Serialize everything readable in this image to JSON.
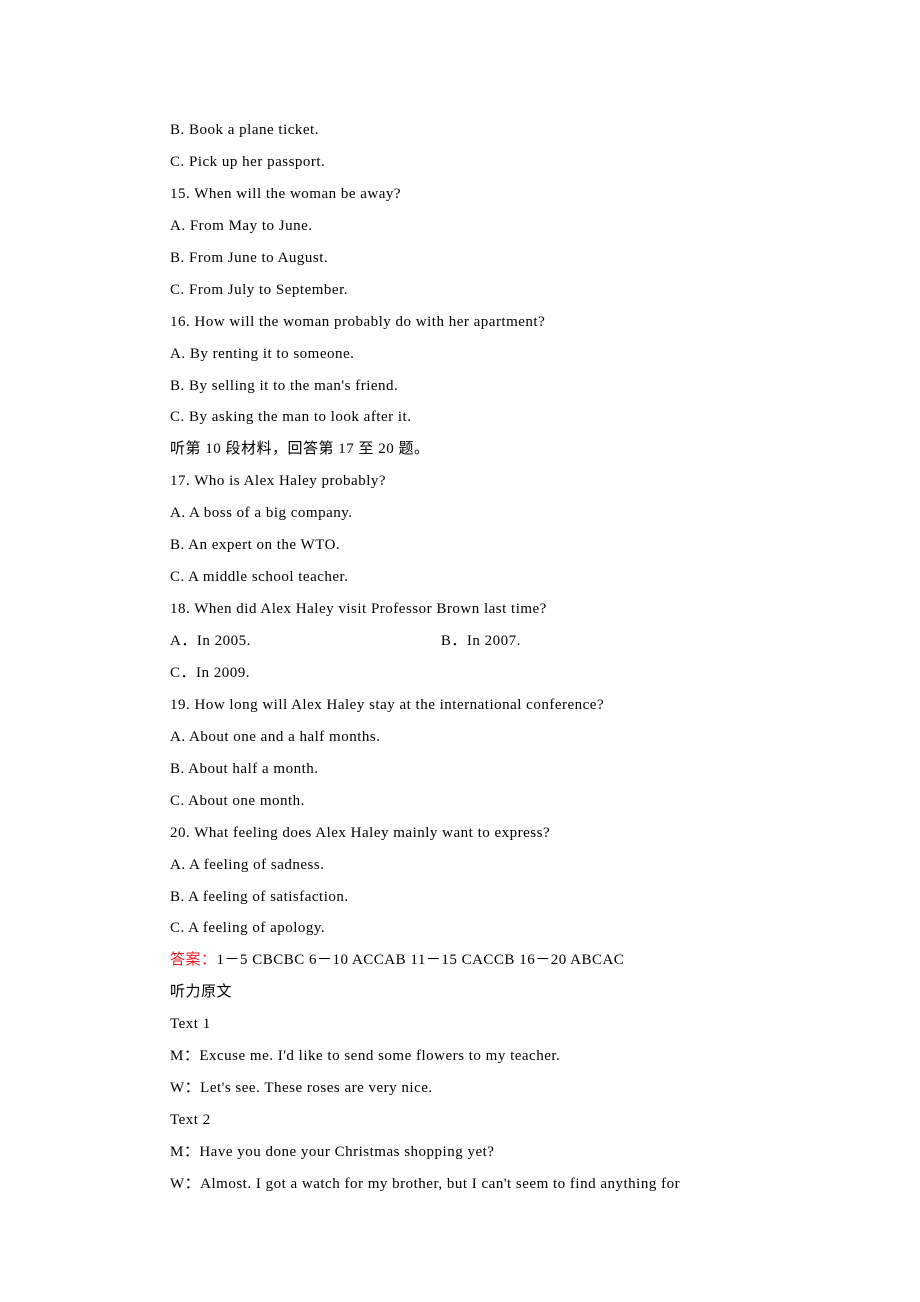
{
  "lines": [
    {
      "text": "B. Book a plane ticket."
    },
    {
      "text": "C. Pick up her passport."
    },
    {
      "text": "15. When will the woman be away?"
    },
    {
      "text": "A. From May to June."
    },
    {
      "text": "B. From June to August."
    },
    {
      "text": "C. From July to September."
    },
    {
      "text": "16. How will the woman probably do with her apartment?"
    },
    {
      "text": "A. By renting it to someone."
    },
    {
      "text": "B. By selling it to the man's friend."
    },
    {
      "text": "C. By asking the man to look after it."
    },
    {
      "text": "听第 10 段材料，回答第 17 至 20 题。"
    },
    {
      "text": "17. Who is Alex Haley probably?"
    },
    {
      "text": "A. A boss of a big company."
    },
    {
      "text": "B. An expert on the WTO."
    },
    {
      "text": "C. A middle school teacher."
    },
    {
      "text": "18. When did Alex Haley visit Professor Brown last time?"
    },
    {
      "type": "split",
      "a": "A．In 2005.",
      "b": "B．In 2007.",
      "gap": 190
    },
    {
      "text": "C．In 2009."
    },
    {
      "text": "19. How long will Alex Haley stay at the international conference?"
    },
    {
      "text": "A. About one and a half months."
    },
    {
      "text": "B. About half a month."
    },
    {
      "text": "C. About one month."
    },
    {
      "text": "20. What feeling does Alex Haley mainly want to express?"
    },
    {
      "text": "A. A feeling of sadness."
    },
    {
      "text": "B. A feeling of satisfaction."
    },
    {
      "text": "C. A feeling of apology."
    },
    {
      "type": "answer",
      "red": "答案：",
      "black": "1－5 CBCBC  6－10 ACCAB  11－15 CACCB  16－20 ABCAC"
    },
    {
      "text": "听力原文"
    },
    {
      "text": "Text 1"
    },
    {
      "text": "M：Excuse me. I'd like to send some flowers to my teacher."
    },
    {
      "text": "W：Let's see. These roses are very nice."
    },
    {
      "text": "Text 2"
    },
    {
      "text": "M：Have you done your Christmas shopping yet?"
    },
    {
      "text": "W：Almost. I got a watch for my brother, but I can't seem to find anything for"
    }
  ]
}
